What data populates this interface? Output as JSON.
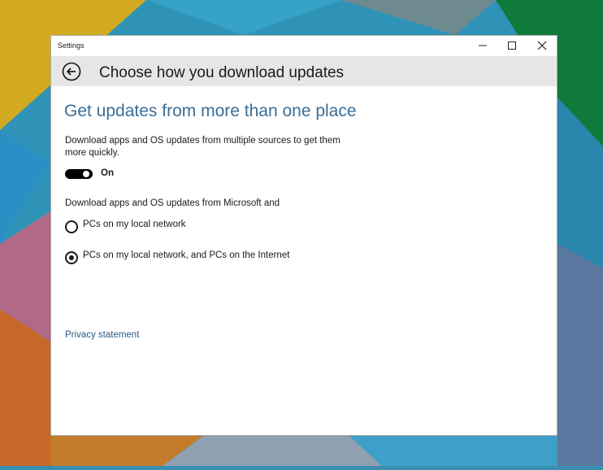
{
  "colors": {
    "accent": "#3c6e96",
    "link": "#2a5a8a",
    "header_bg": "#e6e6e6",
    "toggle_on": "#000000"
  },
  "window": {
    "title": "Settings",
    "controls": {
      "minimize_icon": "minimize-icon",
      "maximize_icon": "maximize-icon",
      "close_icon": "close-icon"
    }
  },
  "header": {
    "back_icon": "back-arrow-icon",
    "title": "Choose how you download updates"
  },
  "main": {
    "section_title": "Get updates from more than one place",
    "description": "Download apps and OS updates from multiple sources to get them more quickly.",
    "toggle": {
      "state": "on",
      "label": "On"
    },
    "group_label": "Download apps and OS updates from Microsoft and",
    "options": [
      {
        "label": "PCs on my local network",
        "selected": false
      },
      {
        "label": "PCs on my local network, and PCs on the Internet",
        "selected": true
      }
    ],
    "privacy_link": "Privacy statement"
  }
}
